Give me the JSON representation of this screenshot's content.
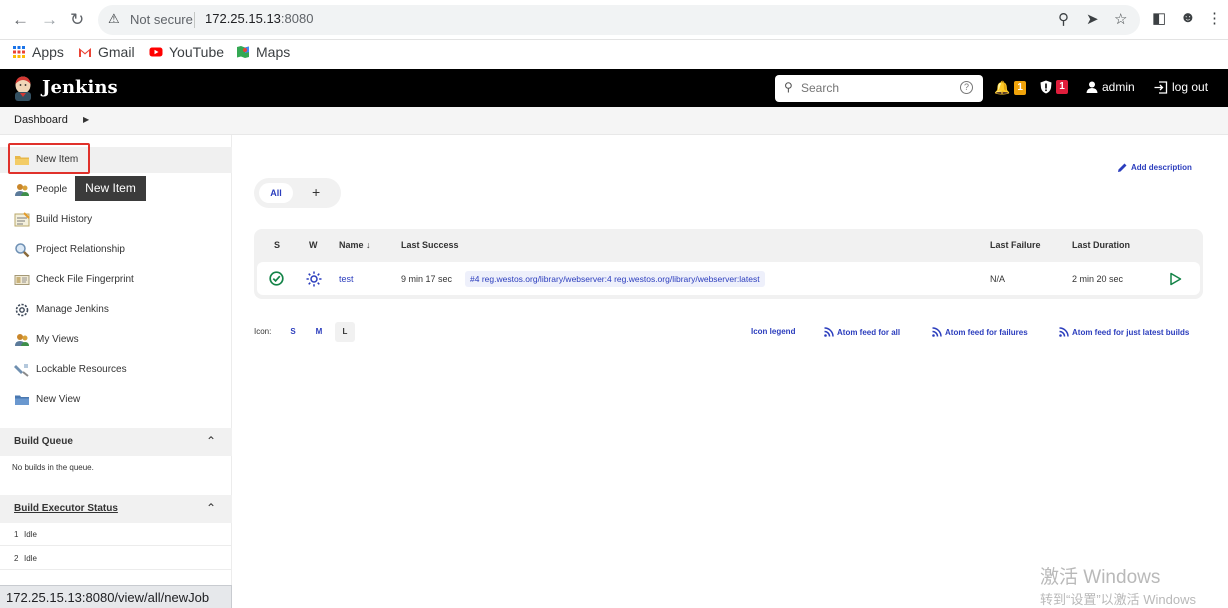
{
  "browser": {
    "url_security": "Not secure",
    "url_host": "172.25.15.13",
    "url_port": ":8080",
    "bookmarks": [
      {
        "label": "Apps",
        "icon": "apps-grid-icon"
      },
      {
        "label": "Gmail",
        "icon": "gmail-icon"
      },
      {
        "label": "YouTube",
        "icon": "youtube-icon"
      },
      {
        "label": "Maps",
        "icon": "maps-icon"
      }
    ],
    "status_url": "172.25.15.13:8080/view/all/newJob"
  },
  "header": {
    "title": "Jenkins",
    "search_placeholder": "Search",
    "notifications_count": "1",
    "security_count": "1",
    "user": "admin",
    "logout": "log out",
    "notification_color": "#f0a30a",
    "security_color": "#e01e3c"
  },
  "breadcrumb": {
    "item": "Dashboard"
  },
  "sidebar": {
    "tasks": [
      {
        "label": "New Item",
        "icon": "new-item-folder-icon"
      },
      {
        "label": "People",
        "icon": "people-icon"
      },
      {
        "label": "Build History",
        "icon": "build-history-icon"
      },
      {
        "label": "Project Relationship",
        "icon": "magnifier-icon"
      },
      {
        "label": "Check File Fingerprint",
        "icon": "fingerprint-icon"
      },
      {
        "label": "Manage Jenkins",
        "icon": "gear-icon"
      },
      {
        "label": "My Views",
        "icon": "people-icon"
      },
      {
        "label": "Lockable Resources",
        "icon": "lock-resources-icon"
      },
      {
        "label": "New View",
        "icon": "folder-icon"
      }
    ],
    "tooltip": "New Item",
    "build_queue": {
      "title": "Build Queue",
      "empty_text": "No builds in the queue."
    },
    "executor_status": {
      "title": "Build Executor Status",
      "rows": [
        {
          "num": "1",
          "state": "Idle"
        },
        {
          "num": "2",
          "state": "Idle"
        }
      ]
    }
  },
  "main": {
    "add_description": "Add description",
    "tabs": {
      "all": "All",
      "add": "+"
    },
    "columns": {
      "s": "S",
      "w": "W",
      "name": "Name ↓",
      "last_success": "Last Success",
      "last_failure": "Last Failure",
      "last_duration": "Last Duration"
    },
    "jobs": [
      {
        "name": "test",
        "last_success": "9 min 17 sec",
        "artifact": "#4 reg.westos.org/library/webserver:4 reg.westos.org/library/webserver:latest",
        "last_failure": "N/A",
        "last_duration": "2 min 20 sec",
        "status_color": "#138347"
      }
    ],
    "icon_size": {
      "label": "Icon:",
      "options": [
        "S",
        "M",
        "L"
      ],
      "selected": "L"
    },
    "links": {
      "icon_legend": "Icon legend",
      "feed_all": "Atom feed for all",
      "feed_failures": "Atom feed for failures",
      "feed_latest": "Atom feed for just latest builds"
    }
  },
  "os_watermark": {
    "line1": "激活 Windows",
    "line2": "转到“设置”以激活 Windows"
  }
}
